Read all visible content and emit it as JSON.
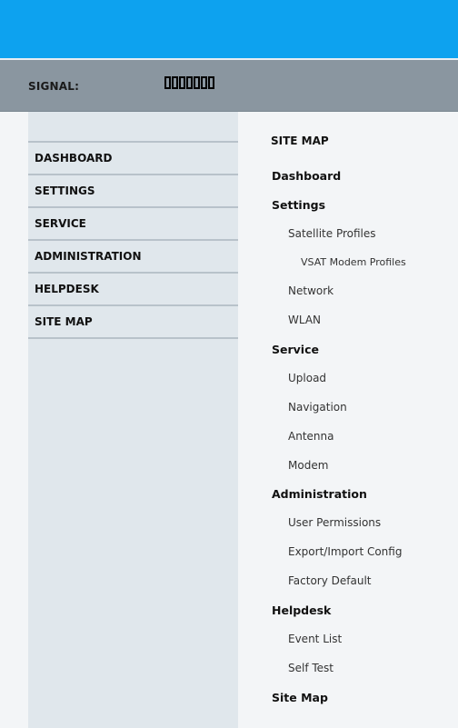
{
  "signal": {
    "label": "SIGNAL:",
    "bars_total": 7,
    "bars_filled": 0
  },
  "nav": {
    "items": [
      {
        "label": "DASHBOARD"
      },
      {
        "label": "SETTINGS"
      },
      {
        "label": "SERVICE"
      },
      {
        "label": "ADMINISTRATION"
      },
      {
        "label": "HELPDESK"
      },
      {
        "label": "SITE MAP"
      }
    ]
  },
  "sitemap": {
    "title": "SITE MAP",
    "items": [
      {
        "label": "Dashboard",
        "level": 1
      },
      {
        "label": "Settings",
        "level": 1
      },
      {
        "label": "Satellite Profiles",
        "level": 2
      },
      {
        "label": "VSAT Modem Profiles",
        "level": 3
      },
      {
        "label": "Network",
        "level": 2
      },
      {
        "label": "WLAN",
        "level": 2
      },
      {
        "label": "Service",
        "level": 1
      },
      {
        "label": "Upload",
        "level": 2
      },
      {
        "label": "Navigation",
        "level": 2
      },
      {
        "label": "Antenna",
        "level": 2
      },
      {
        "label": "Modem",
        "level": 2
      },
      {
        "label": "Administration",
        "level": 1
      },
      {
        "label": "User Permissions",
        "level": 2
      },
      {
        "label": "Export/Import Config",
        "level": 2
      },
      {
        "label": "Factory Default",
        "level": 2
      },
      {
        "label": "Helpdesk",
        "level": 1
      },
      {
        "label": "Event List",
        "level": 2
      },
      {
        "label": "Self Test",
        "level": 2
      },
      {
        "label": "Site Map",
        "level": 1
      }
    ]
  },
  "colors": {
    "header": "#0da2ef",
    "signal_bar": "#8a96a0",
    "sidebar": "#e0e7ec",
    "content": "#f3f5f7"
  }
}
